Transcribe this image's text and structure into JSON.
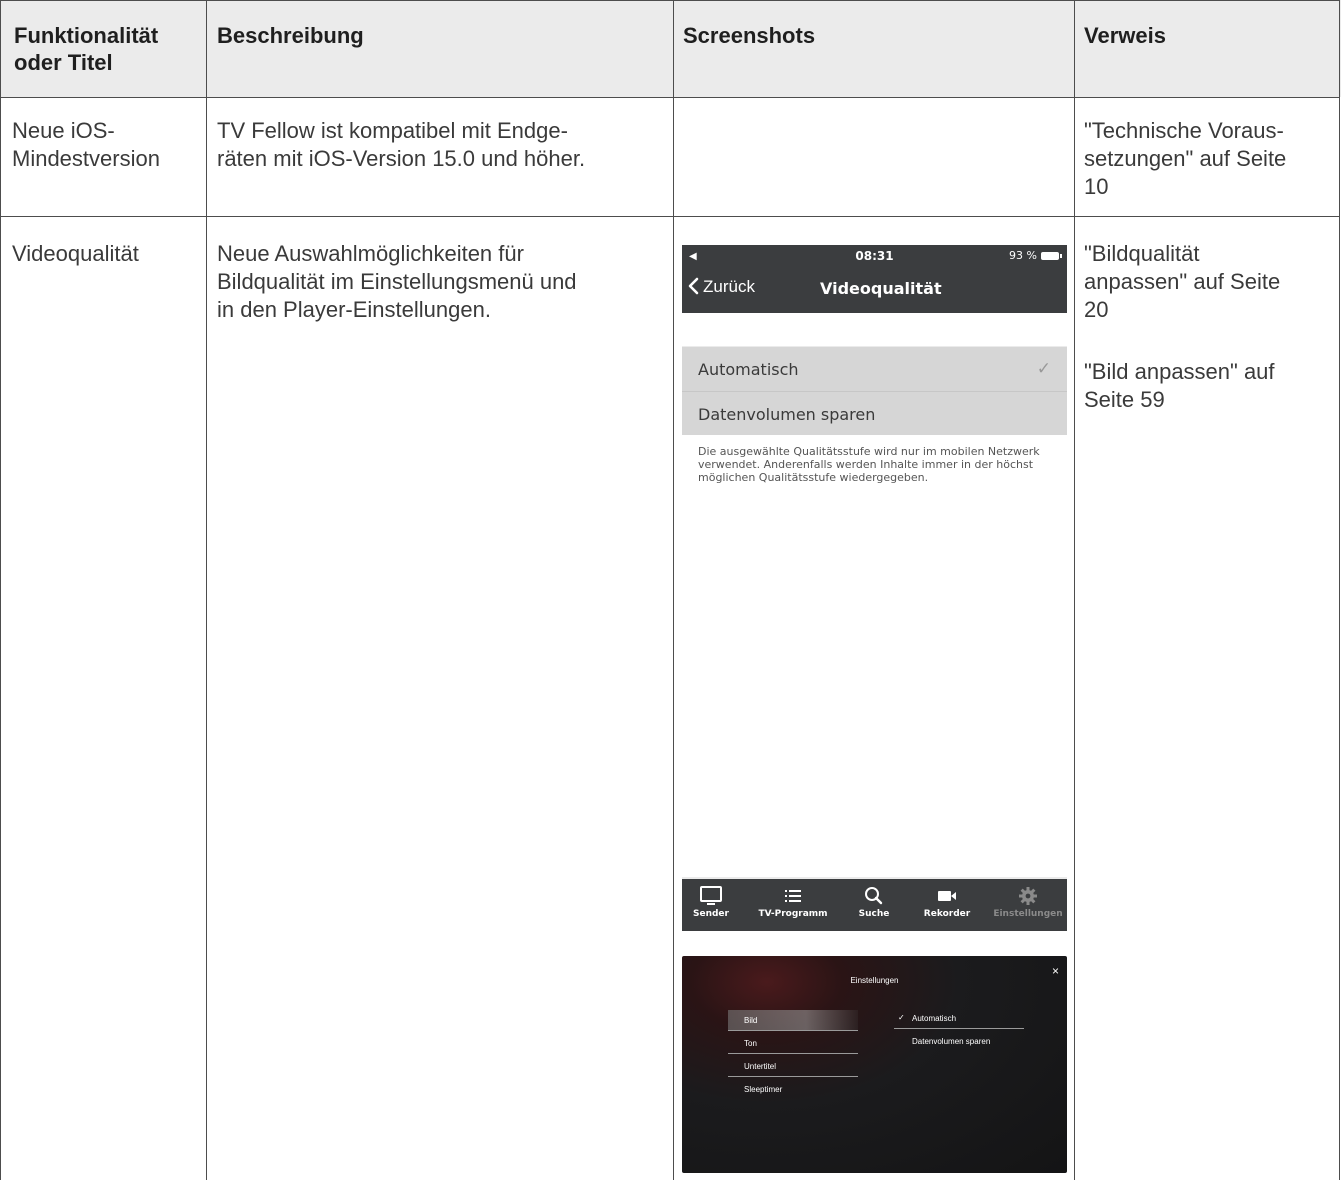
{
  "table": {
    "headers": {
      "col1": "Funktionalität\noder Titel",
      "col2": "Beschreibung",
      "col3": "Screenshots",
      "col4": "Verweis"
    },
    "rows": [
      {
        "title": "Neue iOS-\nMindestversion",
        "description": "TV Fellow ist kompatibel mit Endge-\nräten mit iOS-Version 15.0 und höher.",
        "references": [
          "\"Technische Voraus-\nsetzungen\" auf Seite\n10"
        ]
      },
      {
        "title": "Videoqualität",
        "description": "Neue Auswahlmöglichkeiten für\nBildqualität im Einstellungsmenü und\nin den Player-Einstellungen.",
        "references": [
          "\"Bildqualität\nanpassen\" auf Seite\n20",
          "\"Bild anpassen\" auf\nSeite 59"
        ]
      }
    ]
  },
  "phone": {
    "status_time": "08:31",
    "status_battery": "93 %",
    "back_label": "Zurück",
    "nav_title": "Videoqualität",
    "options": [
      "Automatisch",
      "Datenvolumen sparen"
    ],
    "checkmark": "✓",
    "note": "Die ausgewählte Qualitätsstufe wird nur im mobilen Netzwerk verwendet. Anderenfalls werden Inhalte immer in der höchst möglichen Qualitätsstufe wiedergegeben.",
    "tabs": [
      {
        "label": "Sender",
        "icon": "tv-icon"
      },
      {
        "label": "TV-Programm",
        "icon": "list-icon"
      },
      {
        "label": "Suche",
        "icon": "search-icon"
      },
      {
        "label": "Rekorder",
        "icon": "camera-icon"
      },
      {
        "label": "Einstellungen",
        "icon": "gear-icon"
      }
    ]
  },
  "player": {
    "title": "Einstellungen",
    "close": "×",
    "menu": [
      "Bild",
      "Ton",
      "Untertitel",
      "Sleeptimer"
    ],
    "options": [
      "Automatisch",
      "Datenvolumen sparen"
    ],
    "checkmark": "✓"
  }
}
